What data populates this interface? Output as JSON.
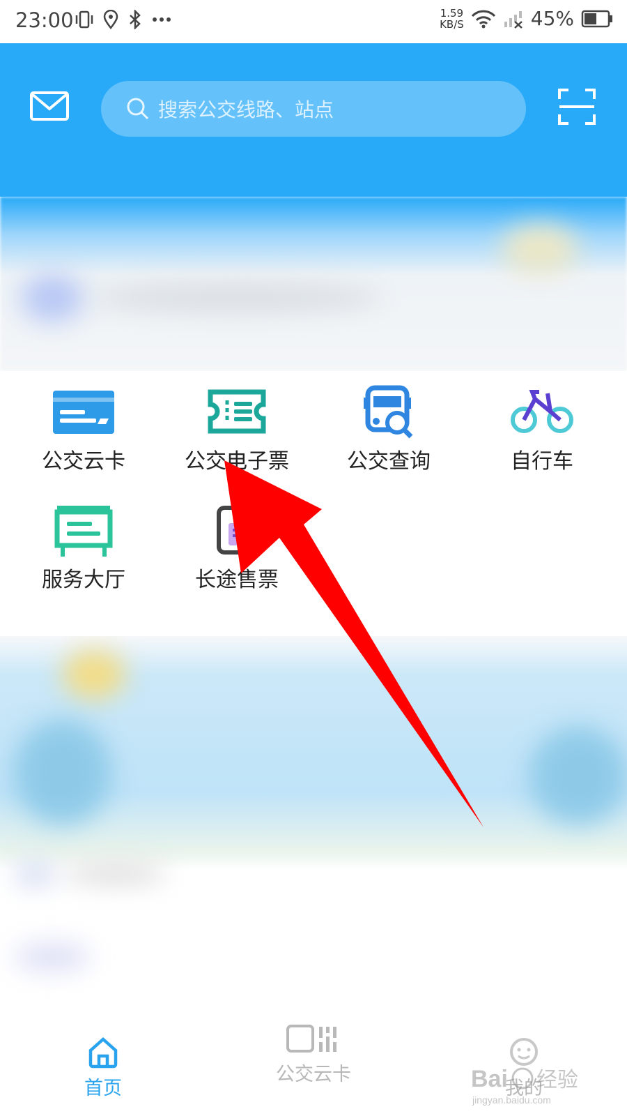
{
  "status_bar": {
    "time": "23:00",
    "net_speed_value": "1.59",
    "net_speed_unit": "KB/S",
    "battery_percent": "45%",
    "icons": [
      "vibrate-icon",
      "location-icon",
      "bluetooth-icon",
      "more-icon",
      "wifi-icon",
      "signal-icon",
      "battery-icon"
    ]
  },
  "header": {
    "search_placeholder": "搜索公交线路、站点",
    "icons": [
      "mail-icon",
      "search-icon",
      "scan-icon"
    ],
    "background": "#29aaf9"
  },
  "services": [
    {
      "label": "公交云卡",
      "icon": "card-icon",
      "color": "#2d9be8"
    },
    {
      "label": "公交电子票",
      "icon": "ticket-icon",
      "color": "#1ba89a"
    },
    {
      "label": "公交查询",
      "icon": "bus-search-icon",
      "color": "#2e86e0"
    },
    {
      "label": "自行车",
      "icon": "bicycle-icon",
      "color": "#4ec9d6"
    },
    {
      "label": "服务大厅",
      "icon": "service-hall-icon",
      "color": "#2bc39a"
    },
    {
      "label": "长途售票",
      "icon": "long-distance-ticket-icon",
      "color": "#444444"
    }
  ],
  "bottom_nav": {
    "items": [
      {
        "label": "首页",
        "icon": "home-icon",
        "active": true
      },
      {
        "label": "公交云卡",
        "icon": "qr-card-icon",
        "active": false
      },
      {
        "label": "我的",
        "icon": "profile-icon",
        "active": false
      }
    ],
    "active_color": "#2aa3ee",
    "inactive_color": "#b8b8b8"
  },
  "watermark": {
    "text": "Bai经验",
    "sub": "jingyan.baidu.com"
  }
}
